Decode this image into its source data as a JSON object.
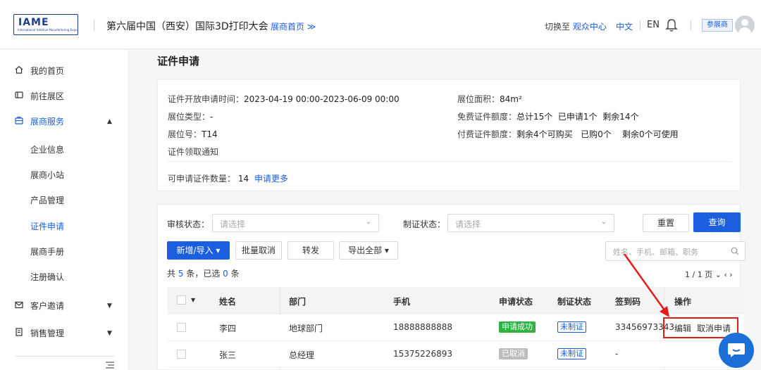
{
  "header": {
    "logo_text": "IAME",
    "logo_sub": "International Additive Manufacturing Expo",
    "title": "第六届中国（西安）国际3D打印大会",
    "exhibitor_home": "展商首页 ≫",
    "switch_prefix": "切换至",
    "switch_link": "观众中心",
    "lang_cn": "中文",
    "lang_en": "EN",
    "role": "参展商"
  },
  "sidebar": {
    "items": [
      {
        "label": "我的首页",
        "icon": "home-icon"
      },
      {
        "label": "前往展区",
        "icon": "door-icon"
      },
      {
        "label": "展商服务",
        "icon": "briefcase-icon"
      },
      {
        "label": "客户邀请",
        "icon": "mail-icon"
      },
      {
        "label": "销售管理",
        "icon": "document-icon"
      }
    ],
    "sub_items": [
      "企业信息",
      "展商小站",
      "产品管理",
      "证件申请",
      "展商手册",
      "注册确认"
    ]
  },
  "main": {
    "page_title": "证件申请",
    "info": {
      "open_time_label": "证件开放申请时间：",
      "open_time_value": "2023-04-19 00:00-2023-06-09 00:00",
      "booth_type_label": "展位类型：",
      "booth_type_value": "-",
      "booth_no_label": "展位号：",
      "booth_no_value": "T14",
      "notice_link": "证件领取通知",
      "area_label": "展位面积：",
      "area_value": "84m²",
      "free_quota_label": "免费证件额度：",
      "free_quota_value": "总计15个  已申请1个  剩余14个",
      "paid_quota_label": "付费证件额度：",
      "paid_quota_value": "剩余4个可购买   已购0个    剩余0个可使用",
      "applicable_label": "可申请证件数量：",
      "applicable_value": "14",
      "apply_more": "申请更多"
    },
    "filters": {
      "review_label": "审核状态：",
      "review_placeholder": "请选择",
      "cert_label": "制证状态：",
      "cert_placeholder": "请选择",
      "reset": "重置",
      "query": "查询"
    },
    "toolbar": {
      "add_import": "新增/导入 ▾",
      "batch_cancel": "批量取消",
      "forward": "转发",
      "export_all": "导出全部 ▾",
      "search_placeholder": "姓名、手机、邮箱、职务"
    },
    "count": {
      "prefix": "共",
      "total": "5",
      "middle": "条，已选",
      "selected": "0",
      "suffix": "条"
    },
    "pager": "1 / 1 页 ⌄ ‹ ›",
    "table": {
      "columns": [
        "姓名",
        "部门",
        "手机",
        "申请状态",
        "制证状态",
        "签到码",
        "操作"
      ],
      "rows": [
        {
          "name": "李四",
          "dept": "地球部门",
          "phone": "18888888888",
          "apply_status": "申请成功",
          "cert_status": "未制证",
          "checkin": "33456973343",
          "op_edit": "编辑",
          "op_cancel": "取消申请"
        },
        {
          "name": "张三",
          "dept": "总经理",
          "phone": "15375226893",
          "apply_status": "已取消",
          "cert_status": "未制证",
          "checkin": "-",
          "op_edit": "",
          "op_cancel": ""
        }
      ]
    }
  },
  "colors": {
    "accent": "#1b5fe0",
    "success": "#2fb344",
    "annotation": "#e41b1b"
  }
}
